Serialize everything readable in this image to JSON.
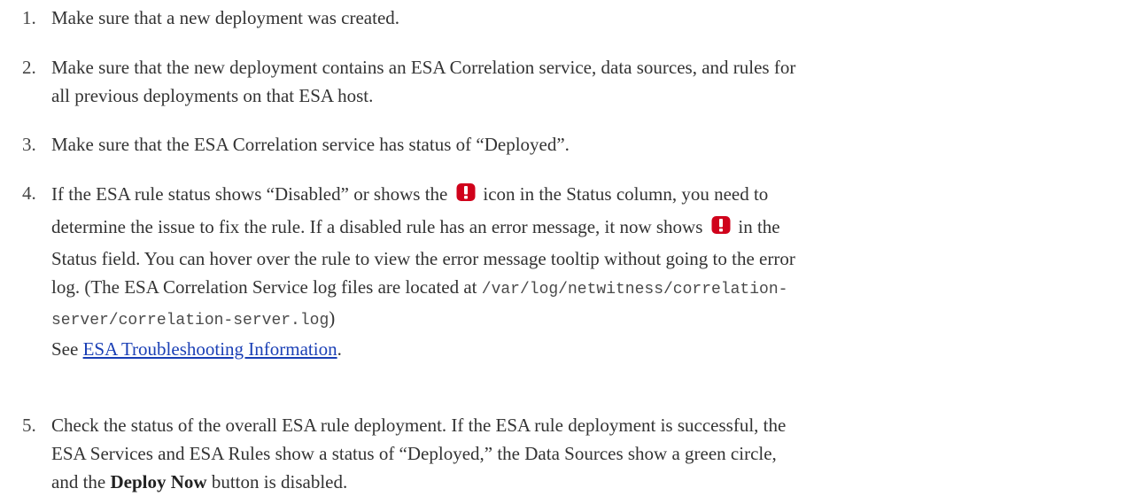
{
  "steps": [
    {
      "number": "1.",
      "text": "Make sure that a new deployment was created."
    },
    {
      "number": "2.",
      "line1": "Make sure that the new deployment contains an ESA Correlation service, data sources, and rules for",
      "line2": "all previous deployments on that ESA host."
    },
    {
      "number": "3.",
      "text": "Make sure that the ESA Correlation service has status of “Deployed”."
    },
    {
      "number": "4.",
      "line1_a": "If the ESA rule status shows “Disabled” or shows the",
      "line1_b": "icon in the Status column, you need to",
      "line2_a": "determine the issue to fix the rule. If a disabled rule has an error message, it now shows",
      "line2_b": "in the",
      "line3": "Status field. You can hover over the rule to view the error message tooltip without going to the error",
      "line4_a": "log. (The ESA Correlation Service log files are located at",
      "line4_code": "/var/log/netwitness/correlation-",
      "line5_code": "server/correlation-server.log",
      "line5_b": ")",
      "line6_a": "See",
      "link_text": "ESA Troubleshooting Information",
      "line6_b": "."
    },
    {
      "number": "5.",
      "line1": "Check the status of the overall ESA rule deployment. If the ESA rule deployment is successful, the",
      "line2": "ESA Services and ESA Rules show a status of “Deployed,” the Data Sources show a green circle,",
      "line3_a": "and the",
      "line3_bold": "Deploy Now",
      "line3_b": "button is disabled."
    }
  ],
  "icons": {
    "error_icon": "error-exclamation-icon",
    "error_color": "#d0021b"
  }
}
